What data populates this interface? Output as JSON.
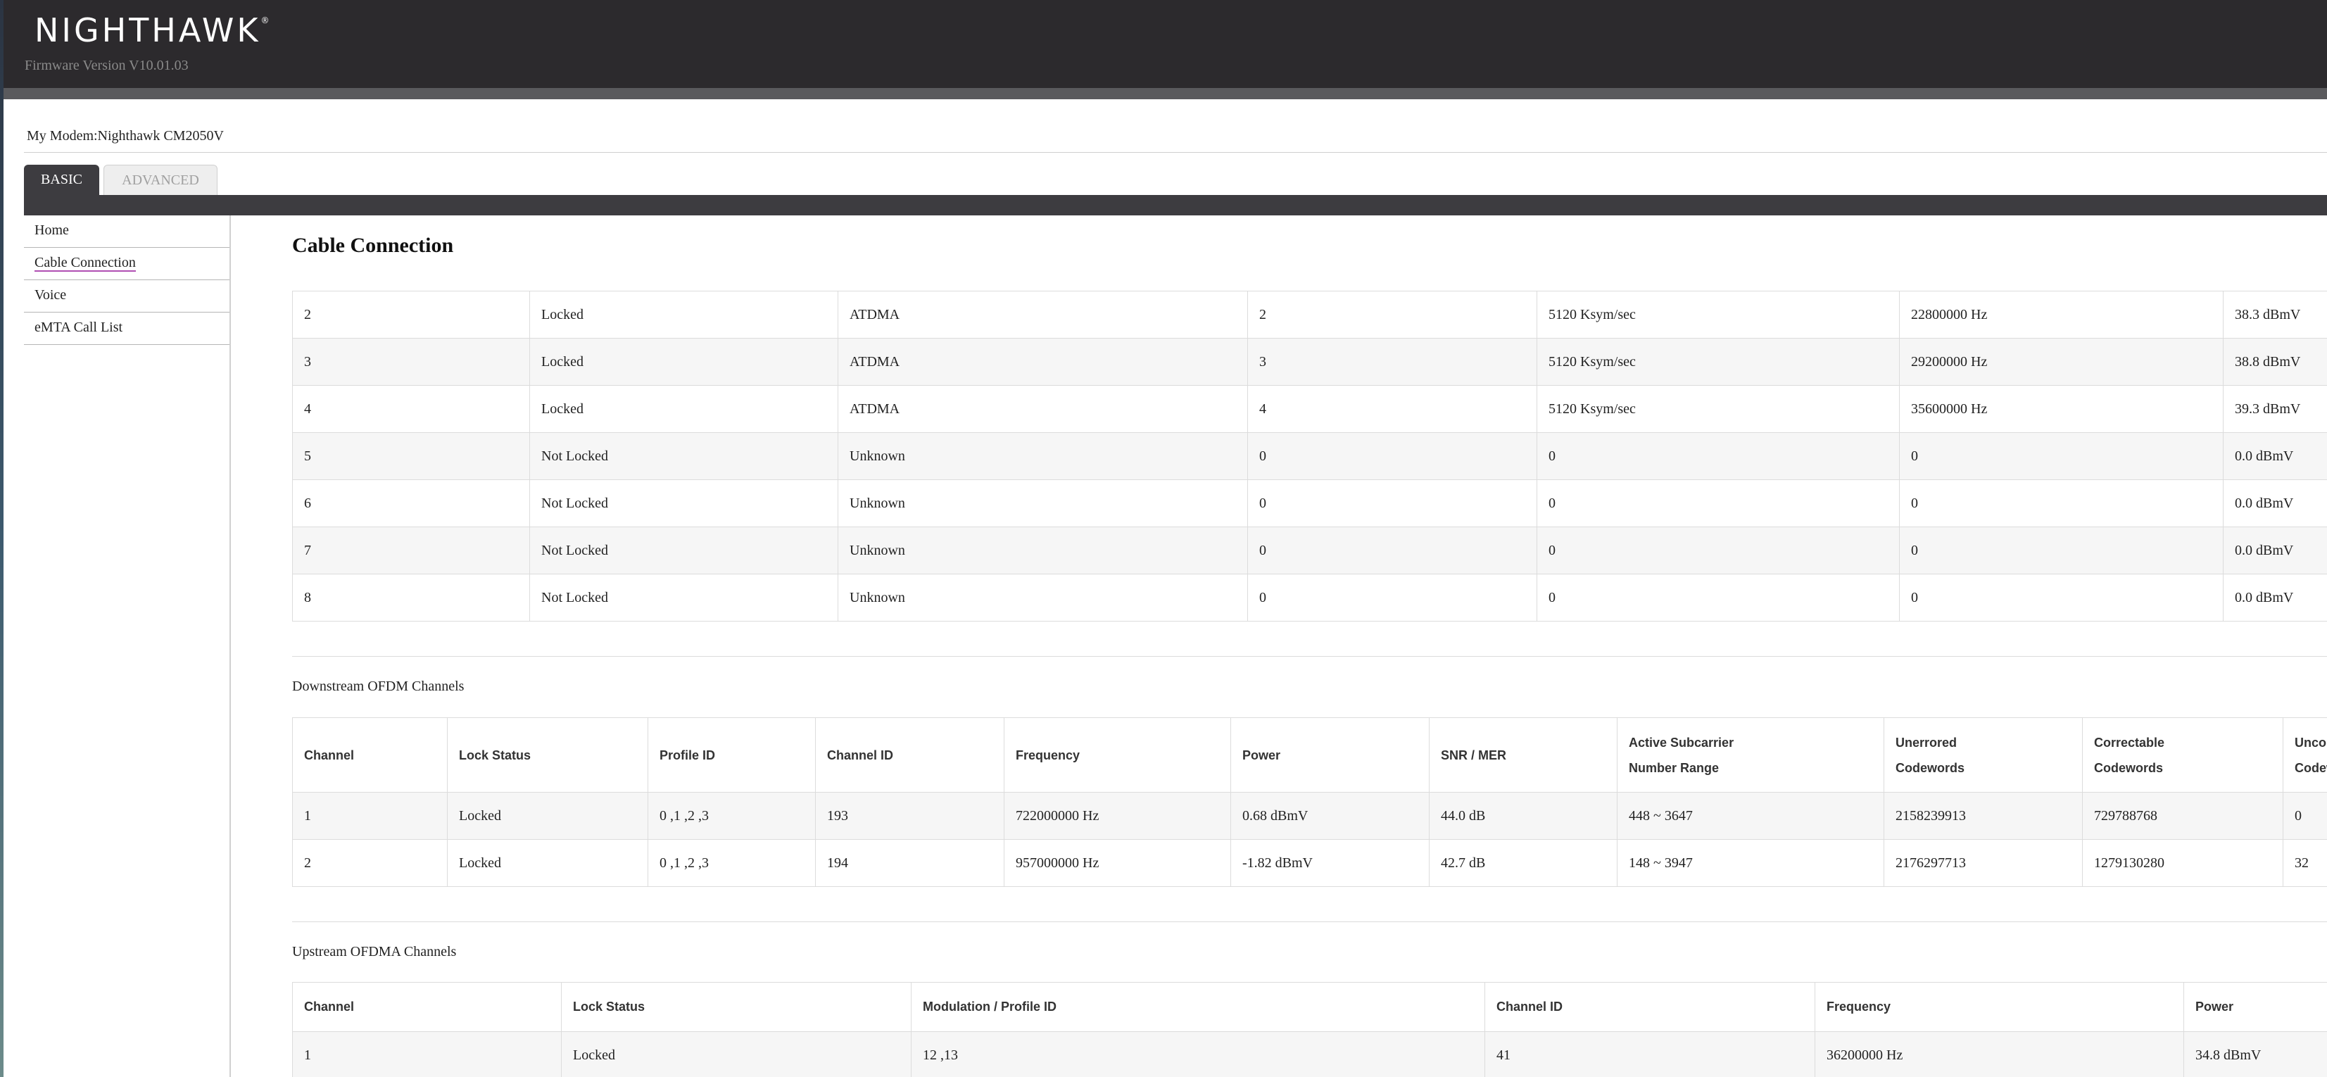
{
  "header": {
    "logo_text": "NIGHTHAWK",
    "logo_mark": "®",
    "firmware": "Firmware Version V10.01.03"
  },
  "modem": "My Modem:Nighthawk CM2050V",
  "tabs": [
    {
      "label": "BASIC",
      "active": true
    },
    {
      "label": "ADVANCED",
      "active": false
    }
  ],
  "sidebar": {
    "items": [
      {
        "label": "Home"
      },
      {
        "label": "Cable Connection",
        "active": true
      },
      {
        "label": "Voice"
      },
      {
        "label": "eMTA Call List"
      }
    ]
  },
  "page_title": "Cable Connection",
  "upstream_bonded": {
    "rows": [
      [
        "2",
        "Locked",
        "ATDMA",
        "2",
        "5120 Ksym/sec",
        "22800000 Hz",
        "38.3 dBmV"
      ],
      [
        "3",
        "Locked",
        "ATDMA",
        "3",
        "5120 Ksym/sec",
        "29200000 Hz",
        "38.8 dBmV"
      ],
      [
        "4",
        "Locked",
        "ATDMA",
        "4",
        "5120 Ksym/sec",
        "35600000 Hz",
        "39.3 dBmV"
      ],
      [
        "5",
        "Not Locked",
        "Unknown",
        "0",
        "0",
        "0",
        "0.0 dBmV"
      ],
      [
        "6",
        "Not Locked",
        "Unknown",
        "0",
        "0",
        "0",
        "0.0 dBmV"
      ],
      [
        "7",
        "Not Locked",
        "Unknown",
        "0",
        "0",
        "0",
        "0.0 dBmV"
      ],
      [
        "8",
        "Not Locked",
        "Unknown",
        "0",
        "0",
        "0",
        "0.0 dBmV"
      ]
    ]
  },
  "downstream_ofdm": {
    "title": "Downstream OFDM Channels",
    "headers": [
      [
        "Channel"
      ],
      [
        "Lock Status"
      ],
      [
        "Profile ID"
      ],
      [
        "Channel ID"
      ],
      [
        "Frequency"
      ],
      [
        "Power"
      ],
      [
        "SNR / MER"
      ],
      [
        "Active Subcarrier",
        "Number Range"
      ],
      [
        "Unerrored",
        "Codewords"
      ],
      [
        "Correctable",
        "Codewords"
      ],
      [
        "Uncorrectable",
        "Codewords"
      ]
    ],
    "rows": [
      [
        "1",
        "Locked",
        "0 ,1 ,2 ,3",
        "193",
        "722000000 Hz",
        "0.68 dBmV",
        "44.0 dB",
        "448 ~ 3647",
        "2158239913",
        "729788768",
        "0"
      ],
      [
        "2",
        "Locked",
        "0 ,1 ,2 ,3",
        "194",
        "957000000 Hz",
        "-1.82 dBmV",
        "42.7 dB",
        "148 ~ 3947",
        "2176297713",
        "1279130280",
        "32"
      ]
    ]
  },
  "upstream_ofdma": {
    "title": "Upstream OFDMA Channels",
    "headers": [
      "Channel",
      "Lock Status",
      "Modulation / Profile ID",
      "Channel ID",
      "Frequency",
      "Power"
    ],
    "rows": [
      [
        "1",
        "Locked",
        "12 ,13",
        "41",
        "36200000 Hz",
        "34.8 dBmV"
      ]
    ]
  }
}
